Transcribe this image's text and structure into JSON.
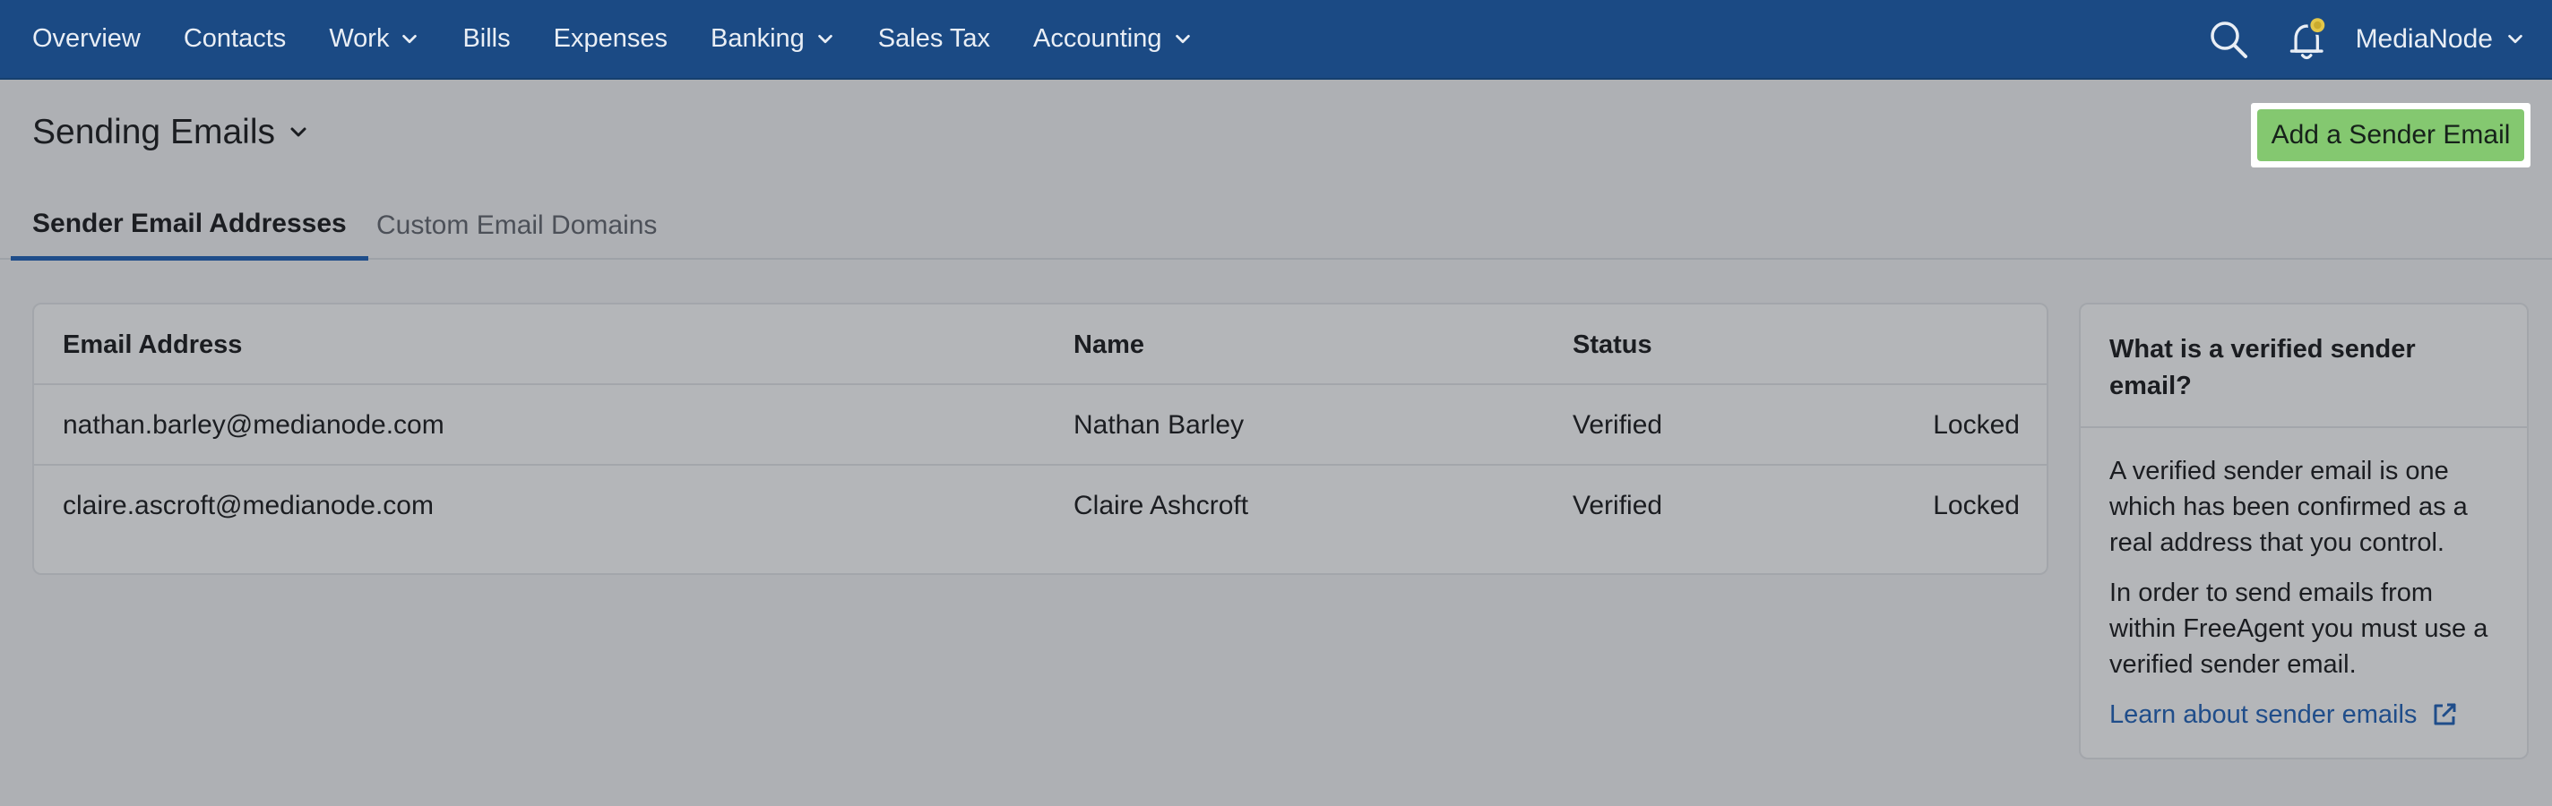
{
  "nav": {
    "items": [
      {
        "label": "Overview",
        "dropdown": false
      },
      {
        "label": "Contacts",
        "dropdown": false
      },
      {
        "label": "Work",
        "dropdown": true
      },
      {
        "label": "Bills",
        "dropdown": false
      },
      {
        "label": "Expenses",
        "dropdown": false
      },
      {
        "label": "Banking",
        "dropdown": true
      },
      {
        "label": "Sales Tax",
        "dropdown": false
      },
      {
        "label": "Accounting",
        "dropdown": true
      }
    ],
    "account": "MediaNode",
    "icons": [
      "search-icon",
      "bell-icon"
    ]
  },
  "page": {
    "title": "Sending Emails",
    "add_button": "Add a Sender Email"
  },
  "tabs": [
    {
      "label": "Sender Email Addresses",
      "active": true
    },
    {
      "label": "Custom Email Domains",
      "active": false
    }
  ],
  "table": {
    "headers": [
      "Email Address",
      "Name",
      "Status"
    ],
    "rows": [
      {
        "email": "nathan.barley@medianode.com",
        "name": "Nathan Barley",
        "status": "Verified",
        "lock": "Locked"
      },
      {
        "email": "claire.ascroft@medianode.com",
        "name": "Claire Ashcroft",
        "status": "Verified",
        "lock": "Locked"
      }
    ]
  },
  "side": {
    "title": "What is a verified sender email?",
    "p1": "A verified sender email is one which has been confirmed as a real address that you control.",
    "p2": "In order to send emails from within FreeAgent you must use a verified sender email.",
    "link": "Learn about sender emails"
  },
  "colors": {
    "nav_bg": "#1b4a84",
    "accent": "#1f4d8a",
    "primary_button": "#84c870",
    "notification_dot": "#e3c74a"
  }
}
